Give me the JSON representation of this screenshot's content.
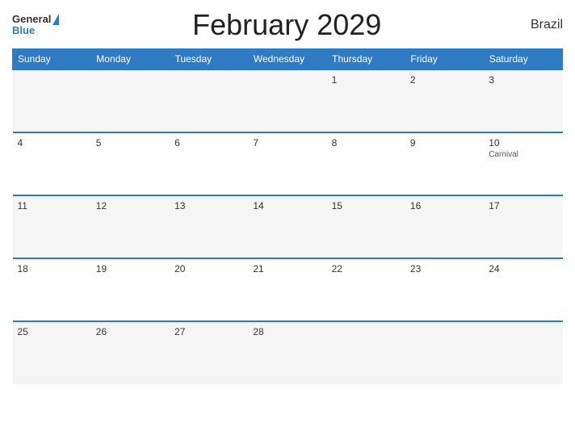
{
  "header": {
    "logo_general": "General",
    "logo_blue": "Blue",
    "title": "February 2029",
    "country": "Brazil"
  },
  "calendar": {
    "weekdays": [
      "Sunday",
      "Monday",
      "Tuesday",
      "Wednesday",
      "Thursday",
      "Friday",
      "Saturday"
    ],
    "weeks": [
      [
        {
          "day": "",
          "event": ""
        },
        {
          "day": "",
          "event": ""
        },
        {
          "day": "",
          "event": ""
        },
        {
          "day": "",
          "event": ""
        },
        {
          "day": "1",
          "event": ""
        },
        {
          "day": "2",
          "event": ""
        },
        {
          "day": "3",
          "event": ""
        }
      ],
      [
        {
          "day": "4",
          "event": ""
        },
        {
          "day": "5",
          "event": ""
        },
        {
          "day": "6",
          "event": ""
        },
        {
          "day": "7",
          "event": ""
        },
        {
          "day": "8",
          "event": ""
        },
        {
          "day": "9",
          "event": ""
        },
        {
          "day": "10",
          "event": "Carnival"
        }
      ],
      [
        {
          "day": "11",
          "event": ""
        },
        {
          "day": "12",
          "event": ""
        },
        {
          "day": "13",
          "event": ""
        },
        {
          "day": "14",
          "event": ""
        },
        {
          "day": "15",
          "event": ""
        },
        {
          "day": "16",
          "event": ""
        },
        {
          "day": "17",
          "event": ""
        }
      ],
      [
        {
          "day": "18",
          "event": ""
        },
        {
          "day": "19",
          "event": ""
        },
        {
          "day": "20",
          "event": ""
        },
        {
          "day": "21",
          "event": ""
        },
        {
          "day": "22",
          "event": ""
        },
        {
          "day": "23",
          "event": ""
        },
        {
          "day": "24",
          "event": ""
        }
      ],
      [
        {
          "day": "25",
          "event": ""
        },
        {
          "day": "26",
          "event": ""
        },
        {
          "day": "27",
          "event": ""
        },
        {
          "day": "28",
          "event": ""
        },
        {
          "day": "",
          "event": ""
        },
        {
          "day": "",
          "event": ""
        },
        {
          "day": "",
          "event": ""
        }
      ]
    ]
  }
}
